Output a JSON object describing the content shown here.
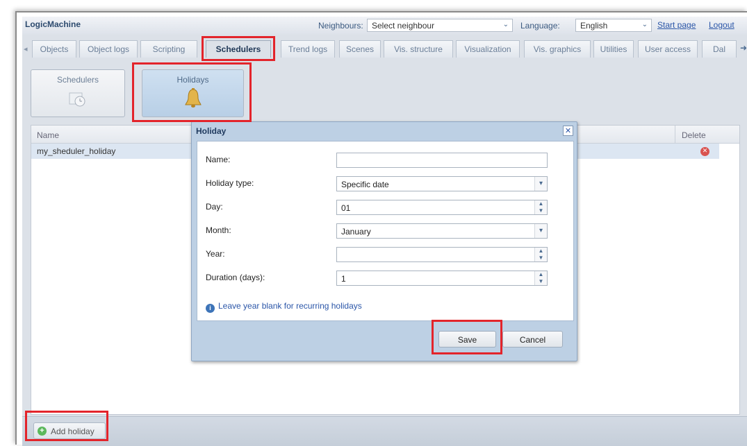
{
  "header": {
    "brand": "LogicMachine",
    "neighbours_label": "Neighbours:",
    "neighbours_value": "Select neighbour",
    "language_label": "Language:",
    "language_value": "English",
    "start_page": "Start page",
    "logout": "Logout"
  },
  "tabs": [
    {
      "label": "Objects"
    },
    {
      "label": "Object logs"
    },
    {
      "label": "Scripting"
    },
    {
      "label": "Schedulers"
    },
    {
      "label": "Trend logs"
    },
    {
      "label": "Scenes"
    },
    {
      "label": "Vis. structure"
    },
    {
      "label": "Visualization"
    },
    {
      "label": "Vis. graphics"
    },
    {
      "label": "Utilities"
    },
    {
      "label": "User access"
    },
    {
      "label": "Dal"
    }
  ],
  "subnav": {
    "schedulers": "Schedulers",
    "holidays": "Holidays"
  },
  "grid": {
    "col_name": "Name",
    "col_delete": "Delete",
    "rows": [
      {
        "name": "my_sheduler_holiday"
      }
    ]
  },
  "footer": {
    "add_holiday": "Add holiday"
  },
  "dialog": {
    "title": "Holiday",
    "close": "✕",
    "name_label": "Name:",
    "name_value": "",
    "type_label": "Holiday type:",
    "type_value": "Specific date",
    "day_label": "Day:",
    "day_value": "01",
    "month_label": "Month:",
    "month_value": "January",
    "year_label": "Year:",
    "year_value": "",
    "duration_label": "Duration (days):",
    "duration_value": "1",
    "info": "Leave year blank for recurring holidays",
    "save": "Save",
    "cancel": "Cancel"
  },
  "colors": {
    "highlight": "#e3242b",
    "accent": "#2b56a8",
    "dialog_bg": "#bdd0e4"
  }
}
